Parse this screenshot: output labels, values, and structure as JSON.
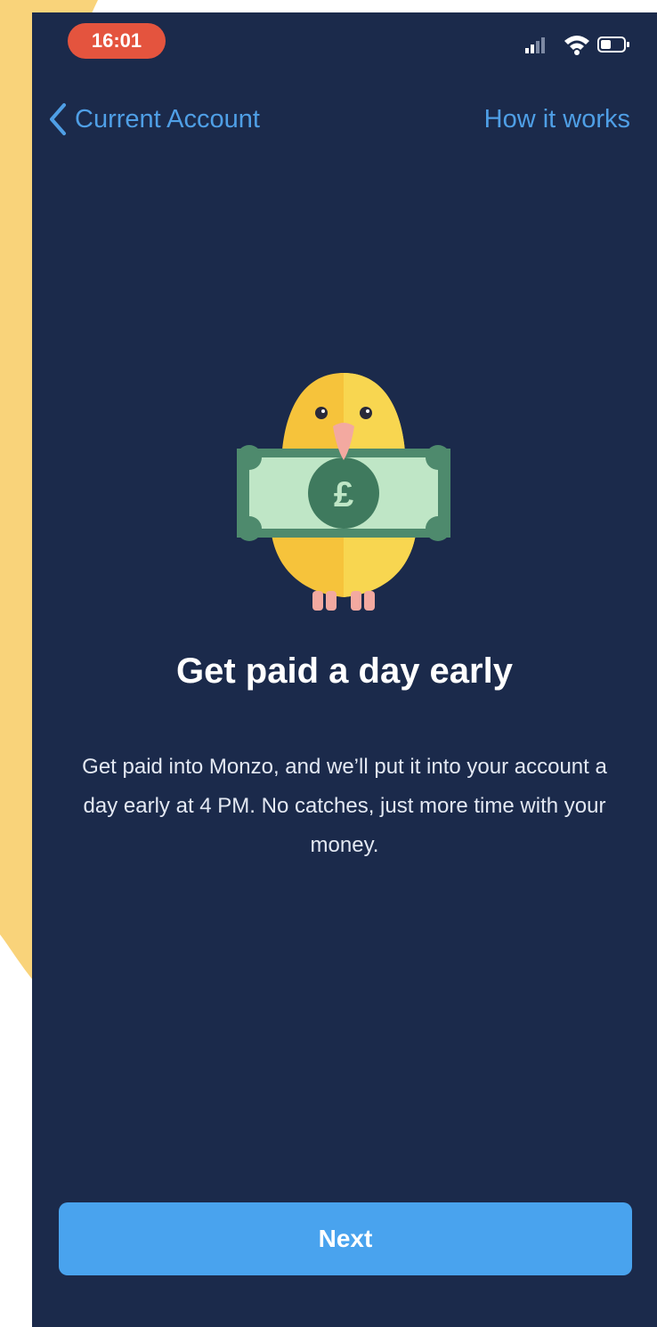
{
  "status_bar": {
    "time": "16:01",
    "icons": [
      "signal-icon",
      "wifi-icon",
      "battery-icon"
    ]
  },
  "nav": {
    "back_label": "Current Account",
    "help_label": "How it works"
  },
  "illustration": {
    "icon": "bird-holding-banknote-icon",
    "currency_symbol": "£"
  },
  "content": {
    "title": "Get paid a day early",
    "description": "Get paid into Monzo, and we’ll put it into your account a day early at 4 PM. No catches, just more time with your money."
  },
  "actions": {
    "next_label": "Next"
  },
  "colors": {
    "background": "#1b2a4b",
    "accent": "#49a3ee",
    "link": "#4f9fe6",
    "time_pill": "#e4543e",
    "outer_backdrop": "#f9d37a"
  }
}
